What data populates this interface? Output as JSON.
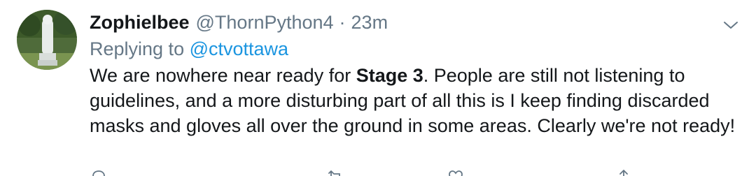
{
  "tweet": {
    "display_name": "Zophielbee",
    "handle": "@ThornPython4",
    "separator": "·",
    "time": "23m",
    "replying_prefix": "Replying to",
    "replying_to": "@ctvottawa",
    "body_before": "We are nowhere near ready for ",
    "body_bold": "Stage 3",
    "body_after": ". People are still not listening to guidelines, and a more disturbing part of all this is I keep finding discarded masks and gloves all over the ground in some areas. Clearly we're not ready!"
  },
  "icons": {
    "menu": "chevron-down-icon",
    "actions": [
      "reply-icon",
      "retweet-icon",
      "like-icon",
      "share-icon"
    ]
  },
  "colors": {
    "text": "#14171a",
    "secondary": "#657786",
    "link": "#1b95e0",
    "background": "#ffffff"
  }
}
